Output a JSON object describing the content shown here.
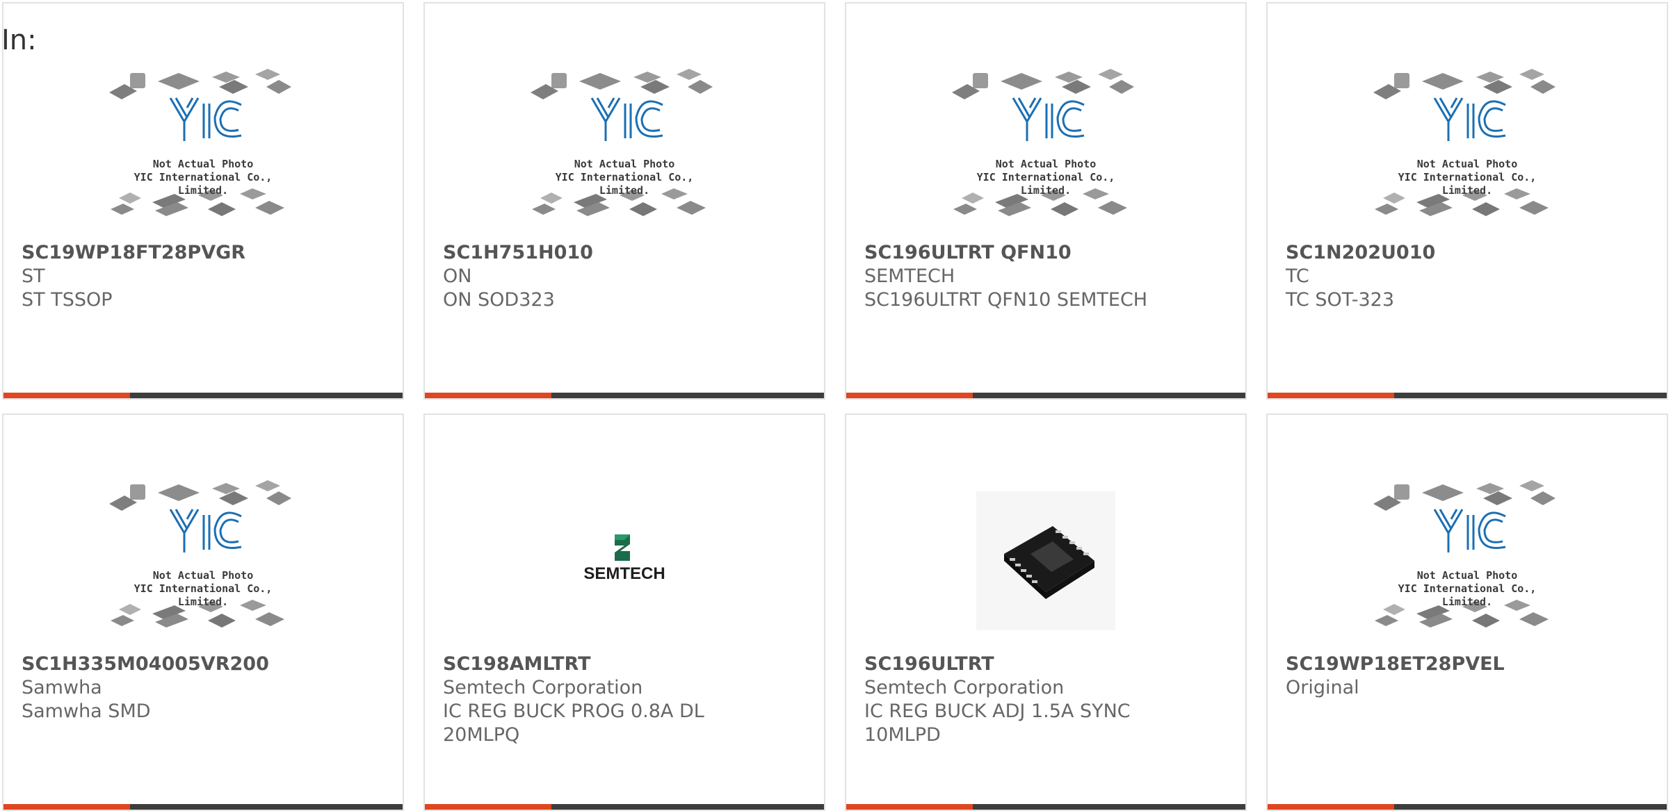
{
  "header": {
    "in_label": "In:"
  },
  "placeholder": {
    "line1": "Not Actual Photo",
    "line2": "YIC International Co., Limited."
  },
  "colors": {
    "accent": "#e0461f",
    "bar": "#3d3d3d",
    "logo": "#1b6fb3"
  },
  "cards": [
    {
      "part": "SC19WP18FT28PVGR",
      "lines": [
        "ST",
        "ST TSSOP",
        ""
      ],
      "image": "placeholder"
    },
    {
      "part": "SC1H751H010",
      "lines": [
        "ON",
        "ON SOD323",
        ""
      ],
      "image": "placeholder"
    },
    {
      "part": "SC196ULTRT QFN10",
      "lines": [
        "SEMTECH",
        "SC196ULTRT QFN10 SEMTECH",
        ""
      ],
      "image": "placeholder"
    },
    {
      "part": "SC1N202U010",
      "lines": [
        "TC",
        "TC SOT-323",
        ""
      ],
      "image": "placeholder"
    },
    {
      "part": "SC1H335M04005VR200",
      "lines": [
        "Samwha",
        "Samwha SMD",
        ""
      ],
      "image": "placeholder"
    },
    {
      "part": "SC198AMLTRT",
      "lines": [
        "Semtech Corporation",
        "IC REG BUCK PROG 0.8A DL",
        "20MLPQ"
      ],
      "image": "semtech-logo",
      "logo_text": "SEMTECH"
    },
    {
      "part": "SC196ULTRT",
      "lines": [
        "Semtech Corporation",
        "IC REG BUCK ADJ 1.5A SYNC",
        "10MLPD"
      ],
      "image": "qfn-chip-photo"
    },
    {
      "part": "SC19WP18ET28PVEL",
      "lines": [
        "Original",
        "",
        ""
      ],
      "image": "placeholder"
    }
  ]
}
